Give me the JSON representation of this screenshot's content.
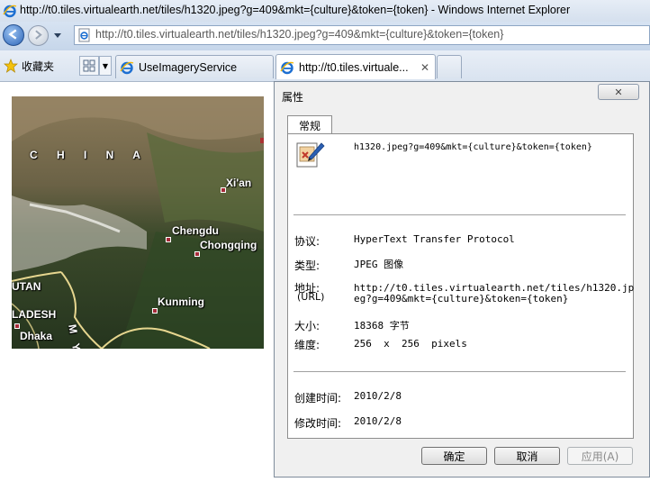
{
  "window": {
    "title": "http://t0.tiles.virtualearth.net/tiles/h1320.jpeg?g=409&mkt={culture}&token={token} - Windows Internet Explorer"
  },
  "navigation": {
    "address": "http://t0.tiles.virtualearth.net/tiles/h1320.jpeg?g=409&mkt={culture}&token={token}",
    "back_icon": "back-arrow-icon",
    "forward_icon": "forward-arrow-icon"
  },
  "toolbar": {
    "favorites_label": "收藏夹",
    "favorites_icon": "star-icon"
  },
  "tabs": [
    {
      "label": "UseImageryService"
    },
    {
      "label": "http://t0.tiles.virtuale..."
    }
  ],
  "map": {
    "labels": {
      "china": "C H I N A",
      "xian": "Xi'an",
      "chengdu": "Chengdu",
      "chongqing": "Chongqing",
      "kunming": "Kunming",
      "bhutan": "UTAN",
      "bangladesh": "LADESH",
      "dhaka": "Dhaka",
      "myanmar": "M Y"
    }
  },
  "dialog": {
    "title": "属性",
    "close_glyph": "✕",
    "tab_general": "常规",
    "file_name": "h1320.jpeg?g=409&mkt={culture}&token={token}",
    "props": {
      "protocol_label": "协议:",
      "protocol_value": "HyperText Transfer Protocol",
      "type_label": "类型:",
      "type_value": "JPEG 图像",
      "address_label": "地址:",
      "address_label_sub": "(URL)",
      "address_value_line1": "http://t0.tiles.virtualearth.net/tiles/h1320.jp",
      "address_value_line2": "eg?g=409&mkt={culture}&token={token}",
      "size_label": "大小:",
      "size_value": "18368 字节",
      "dimensions_label": "维度:",
      "dimensions_value": "256  x  256  pixels",
      "created_label": "创建时间:",
      "created_value": "2010/2/8",
      "modified_label": "修改时间:",
      "modified_value": "2010/2/8"
    },
    "buttons": {
      "ok": "确定",
      "cancel": "取消",
      "apply": "应用(A)"
    }
  },
  "colors": {
    "chrome_blue": "#c6d6ea",
    "dialog_bg": "#f0f0f0",
    "map_marker": "#a62a38"
  }
}
